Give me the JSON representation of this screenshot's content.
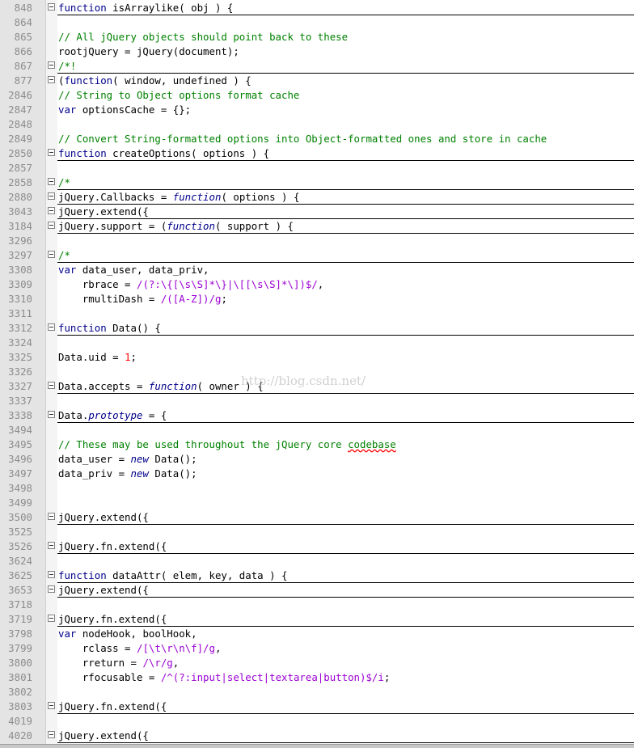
{
  "editor": {
    "watermark": "http://blog.csdn.net/",
    "colors": {
      "keyword": "#00008b",
      "comment": "#008000",
      "string": "#9b00d3",
      "number": "#ff0000",
      "line_number": "#8c8c8c",
      "gutter": "#e4e4e4"
    },
    "lines": [
      {
        "n": "848",
        "fold": true,
        "folded": true,
        "tokens": [
          [
            "kw",
            "function"
          ],
          [
            "t",
            " isArraylike( obj ) {"
          ]
        ]
      },
      {
        "n": "864",
        "fold": false,
        "folded": false,
        "tokens": []
      },
      {
        "n": "865",
        "fold": false,
        "folded": false,
        "tokens": [
          [
            "cm",
            "// All jQuery objects should point back to these"
          ]
        ]
      },
      {
        "n": "866",
        "fold": false,
        "folded": false,
        "tokens": [
          [
            "t",
            "rootjQuery = jQuery(document);"
          ]
        ]
      },
      {
        "n": "867",
        "fold": true,
        "folded": true,
        "tokens": [
          [
            "cm",
            "/*!"
          ]
        ]
      },
      {
        "n": "877",
        "fold": true,
        "folded": false,
        "tokens": [
          [
            "t",
            "("
          ],
          [
            "kw",
            "function"
          ],
          [
            "t",
            "( window, undefined ) {"
          ]
        ]
      },
      {
        "n": "2846",
        "fold": false,
        "folded": false,
        "tokens": [
          [
            "cm",
            "// String to Object options format cache"
          ]
        ]
      },
      {
        "n": "2847",
        "fold": false,
        "folded": false,
        "tokens": [
          [
            "kw",
            "var"
          ],
          [
            "t",
            " optionsCache = {};"
          ]
        ]
      },
      {
        "n": "2848",
        "fold": false,
        "folded": false,
        "tokens": []
      },
      {
        "n": "2849",
        "fold": false,
        "folded": false,
        "tokens": [
          [
            "cm",
            "// Convert String-formatted options into Object-formatted ones and store in cache"
          ]
        ]
      },
      {
        "n": "2850",
        "fold": true,
        "folded": true,
        "tokens": [
          [
            "kw",
            "function"
          ],
          [
            "t",
            " createOptions( options ) {"
          ]
        ]
      },
      {
        "n": "2857",
        "fold": false,
        "folded": false,
        "tokens": []
      },
      {
        "n": "2858",
        "fold": true,
        "folded": true,
        "tokens": [
          [
            "cm",
            "/*"
          ]
        ]
      },
      {
        "n": "2880",
        "fold": true,
        "folded": true,
        "tokens": [
          [
            "t",
            "jQuery.Callbacks = "
          ],
          [
            "kwi",
            "function"
          ],
          [
            "t",
            "( options ) {"
          ]
        ]
      },
      {
        "n": "3043",
        "fold": true,
        "folded": true,
        "tokens": [
          [
            "t",
            "jQuery.extend({"
          ]
        ]
      },
      {
        "n": "3184",
        "fold": true,
        "folded": true,
        "tokens": [
          [
            "t",
            "jQuery.support = ("
          ],
          [
            "kwi",
            "function"
          ],
          [
            "t",
            "( support ) {"
          ]
        ]
      },
      {
        "n": "3296",
        "fold": false,
        "folded": false,
        "tokens": []
      },
      {
        "n": "3297",
        "fold": true,
        "folded": true,
        "tokens": [
          [
            "cm",
            "/*"
          ]
        ]
      },
      {
        "n": "3308",
        "fold": false,
        "folded": false,
        "tokens": [
          [
            "kw",
            "var"
          ],
          [
            "t",
            " data_user, data_priv,"
          ]
        ]
      },
      {
        "n": "3309",
        "fold": false,
        "folded": false,
        "tokens": [
          [
            "t",
            "    rbrace = "
          ],
          [
            "str",
            "/(?:\\{[\\s\\S]*\\}|\\[[\\s\\S]*\\])$/"
          ],
          [
            "t",
            ","
          ]
        ]
      },
      {
        "n": "3310",
        "fold": false,
        "folded": false,
        "tokens": [
          [
            "t",
            "    rmultiDash = "
          ],
          [
            "str",
            "/([A-Z])/g"
          ],
          [
            "t",
            ";"
          ]
        ]
      },
      {
        "n": "3311",
        "fold": false,
        "folded": false,
        "tokens": []
      },
      {
        "n": "3312",
        "fold": true,
        "folded": true,
        "tokens": [
          [
            "kw",
            "function"
          ],
          [
            "t",
            " Data() {"
          ]
        ]
      },
      {
        "n": "3324",
        "fold": false,
        "folded": false,
        "tokens": []
      },
      {
        "n": "3325",
        "fold": false,
        "folded": false,
        "tokens": [
          [
            "t",
            "Data.uid = "
          ],
          [
            "num",
            "1"
          ],
          [
            "t",
            ";"
          ]
        ]
      },
      {
        "n": "3326",
        "fold": false,
        "folded": false,
        "tokens": []
      },
      {
        "n": "3327",
        "fold": true,
        "folded": true,
        "tokens": [
          [
            "t",
            "Data.accepts = "
          ],
          [
            "kwi",
            "function"
          ],
          [
            "t",
            "( owner ) {"
          ]
        ]
      },
      {
        "n": "3337",
        "fold": false,
        "folded": false,
        "tokens": []
      },
      {
        "n": "3338",
        "fold": true,
        "folded": true,
        "tokens": [
          [
            "t",
            "Data."
          ],
          [
            "kwi",
            "prototype"
          ],
          [
            "t",
            " = {"
          ]
        ]
      },
      {
        "n": "3494",
        "fold": false,
        "folded": false,
        "tokens": []
      },
      {
        "n": "3495",
        "fold": false,
        "folded": false,
        "tokens": [
          [
            "cm",
            "// These may be used throughout the jQuery core "
          ],
          [
            "sqcm",
            "codebase"
          ]
        ]
      },
      {
        "n": "3496",
        "fold": false,
        "folded": false,
        "tokens": [
          [
            "t",
            "data_user = "
          ],
          [
            "kwi",
            "new"
          ],
          [
            "t",
            " Data();"
          ]
        ]
      },
      {
        "n": "3497",
        "fold": false,
        "folded": false,
        "tokens": [
          [
            "t",
            "data_priv = "
          ],
          [
            "kwi",
            "new"
          ],
          [
            "t",
            " Data();"
          ]
        ]
      },
      {
        "n": "3498",
        "fold": false,
        "folded": false,
        "tokens": []
      },
      {
        "n": "3499",
        "fold": false,
        "folded": false,
        "tokens": []
      },
      {
        "n": "3500",
        "fold": true,
        "folded": true,
        "tokens": [
          [
            "t",
            "jQuery.extend({"
          ]
        ]
      },
      {
        "n": "3525",
        "fold": false,
        "folded": false,
        "tokens": []
      },
      {
        "n": "3526",
        "fold": true,
        "folded": true,
        "tokens": [
          [
            "t",
            "jQuery.fn.extend({"
          ]
        ]
      },
      {
        "n": "3624",
        "fold": false,
        "folded": false,
        "tokens": []
      },
      {
        "n": "3625",
        "fold": true,
        "folded": true,
        "tokens": [
          [
            "kw",
            "function"
          ],
          [
            "t",
            " dataAttr( elem, key, data ) {"
          ]
        ]
      },
      {
        "n": "3653",
        "fold": true,
        "folded": true,
        "tokens": [
          [
            "t",
            "jQuery.extend({"
          ]
        ]
      },
      {
        "n": "3718",
        "fold": false,
        "folded": false,
        "tokens": []
      },
      {
        "n": "3719",
        "fold": true,
        "folded": true,
        "tokens": [
          [
            "t",
            "jQuery.fn.extend({"
          ]
        ]
      },
      {
        "n": "3798",
        "fold": false,
        "folded": false,
        "tokens": [
          [
            "kw",
            "var"
          ],
          [
            "t",
            " nodeHook, boolHook,"
          ]
        ]
      },
      {
        "n": "3799",
        "fold": false,
        "folded": false,
        "tokens": [
          [
            "t",
            "    rclass = "
          ],
          [
            "str",
            "/[\\t\\r\\n\\f]/g"
          ],
          [
            "t",
            ","
          ]
        ]
      },
      {
        "n": "3800",
        "fold": false,
        "folded": false,
        "tokens": [
          [
            "t",
            "    rreturn = "
          ],
          [
            "str",
            "/\\r/g"
          ],
          [
            "t",
            ","
          ]
        ]
      },
      {
        "n": "3801",
        "fold": false,
        "folded": false,
        "tokens": [
          [
            "t",
            "    rfocusable = "
          ],
          [
            "str",
            "/^(?:input|select|textarea|button)$/i"
          ],
          [
            "t",
            ";"
          ]
        ]
      },
      {
        "n": "3802",
        "fold": false,
        "folded": false,
        "tokens": []
      },
      {
        "n": "3803",
        "fold": true,
        "folded": true,
        "tokens": [
          [
            "t",
            "jQuery.fn.extend({"
          ]
        ]
      },
      {
        "n": "4019",
        "fold": false,
        "folded": false,
        "tokens": []
      },
      {
        "n": "4020",
        "fold": true,
        "folded": true,
        "tokens": [
          [
            "t",
            "jQuery.extend({"
          ]
        ]
      }
    ]
  }
}
